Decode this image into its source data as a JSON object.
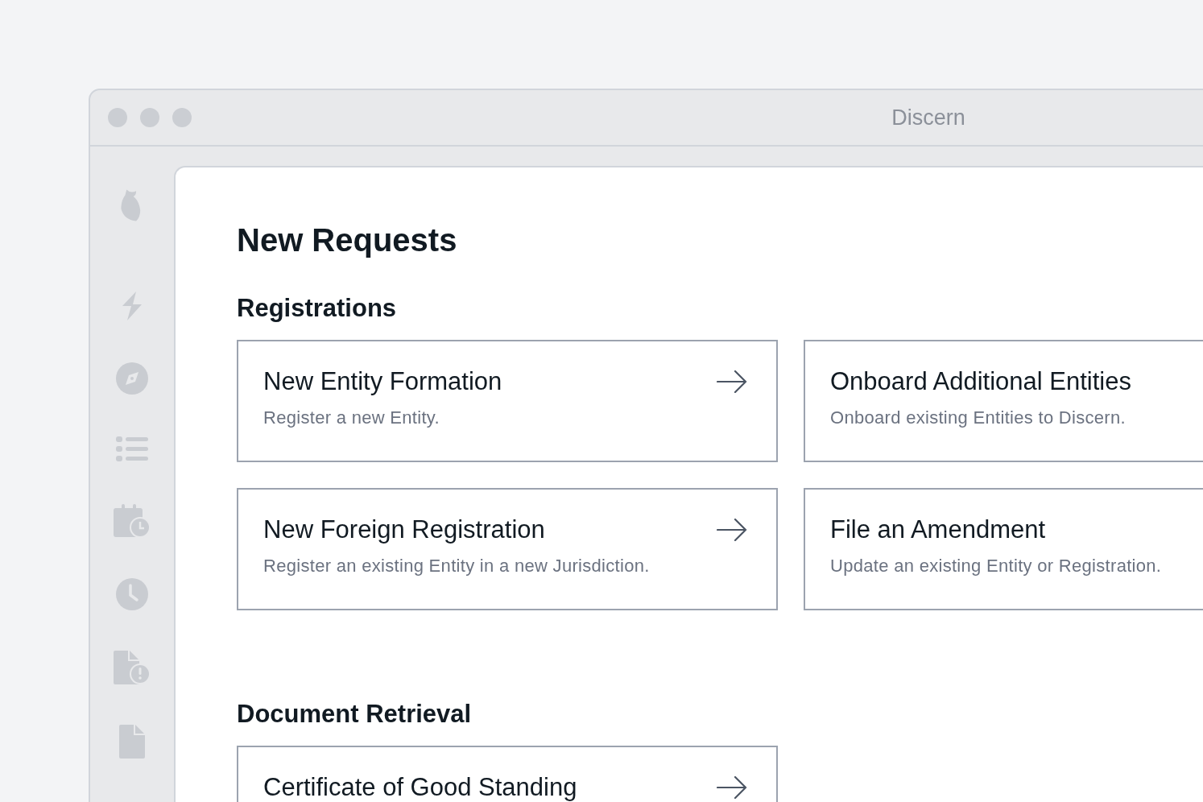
{
  "window": {
    "title": "Discern"
  },
  "sidebar": {
    "items": [
      {
        "kind": "bolt"
      },
      {
        "kind": "compass"
      },
      {
        "kind": "list"
      },
      {
        "kind": "calendar-clock"
      },
      {
        "kind": "clock"
      },
      {
        "kind": "file-alert"
      },
      {
        "kind": "file"
      }
    ]
  },
  "page": {
    "title": "New Requests"
  },
  "sections": [
    {
      "title": "Registrations",
      "cards": [
        {
          "title": "New Entity Formation",
          "description": "Register a new Entity."
        },
        {
          "title": "Onboard Additional Entities",
          "description": "Onboard existing Entities to Discern."
        },
        {
          "title": "New Foreign Registration",
          "description": "Register an existing Entity in a new Jurisdiction."
        },
        {
          "title": "File an Amendment",
          "description": "Update an existing Entity or Registration."
        }
      ]
    },
    {
      "title": "Document Retrieval",
      "cards": [
        {
          "title": "Certificate of Good Standing"
        }
      ]
    }
  ]
}
